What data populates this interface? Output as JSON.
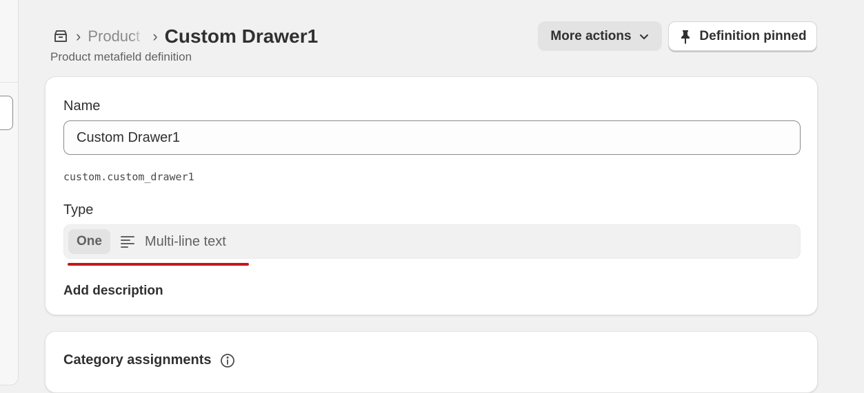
{
  "header": {
    "breadcrumb_parent": "Product",
    "title": "Custom Drawer1",
    "subtitle": "Product metafield definition",
    "more_actions_label": "More actions",
    "definition_pinned_label": "Definition pinned"
  },
  "definition": {
    "name_label": "Name",
    "name_value": "Custom Drawer1",
    "namespace_key": "custom.custom_drawer1",
    "type_label": "Type",
    "type_badge": "One",
    "type_value": "Multi-line text",
    "add_description_label": "Add description"
  },
  "category": {
    "title": "Category assignments"
  },
  "icons": {
    "breadcrumb": "product-box-icon",
    "more_actions": "chevron-down-icon",
    "pinned": "pin-icon",
    "type": "multiline-text-icon",
    "info": "info-icon"
  },
  "colors": {
    "accent_underline": "#c4161c",
    "background": "#f1f1f1",
    "card": "#ffffff"
  }
}
